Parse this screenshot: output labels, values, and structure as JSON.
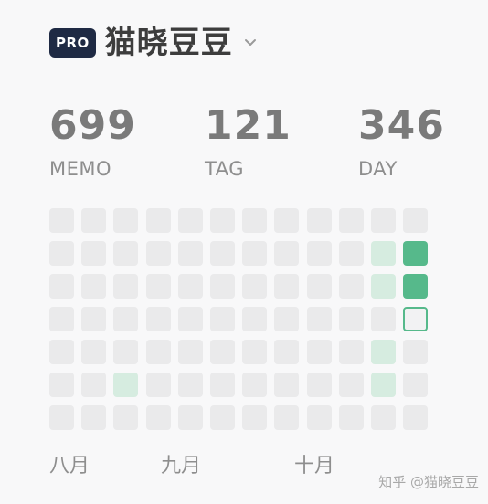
{
  "header": {
    "badge": "PRO",
    "username": "猫晓豆豆",
    "dropdown_icon": "chevron-down-icon"
  },
  "stats": [
    {
      "value": "699",
      "label": "MEMO"
    },
    {
      "value": "121",
      "label": "TAG"
    },
    {
      "value": "346",
      "label": "DAY"
    }
  ],
  "heatmap": {
    "columns": 12,
    "rows": 7,
    "colors": {
      "empty": "#eaeaeb",
      "light": "#d6ece0",
      "dark": "#56b98b"
    },
    "levels": [
      [
        0,
        0,
        0,
        0,
        0,
        0,
        0,
        0,
        0,
        0,
        0,
        0
      ],
      [
        0,
        0,
        0,
        0,
        0,
        0,
        0,
        0,
        0,
        0,
        1,
        2
      ],
      [
        0,
        0,
        0,
        0,
        0,
        0,
        0,
        0,
        0,
        0,
        1,
        2
      ],
      [
        0,
        0,
        0,
        0,
        0,
        0,
        0,
        0,
        0,
        0,
        0,
        0
      ],
      [
        0,
        0,
        0,
        0,
        0,
        0,
        0,
        0,
        0,
        0,
        1,
        0
      ],
      [
        0,
        0,
        1,
        0,
        0,
        0,
        0,
        0,
        0,
        0,
        1,
        0
      ],
      [
        0,
        0,
        0,
        0,
        0,
        0,
        0,
        0,
        0,
        0,
        0,
        0
      ]
    ],
    "today": {
      "row": 3,
      "col": 11
    }
  },
  "months": [
    "八月",
    "九月",
    "十月"
  ],
  "watermark": "知乎 @猫晓豆豆"
}
